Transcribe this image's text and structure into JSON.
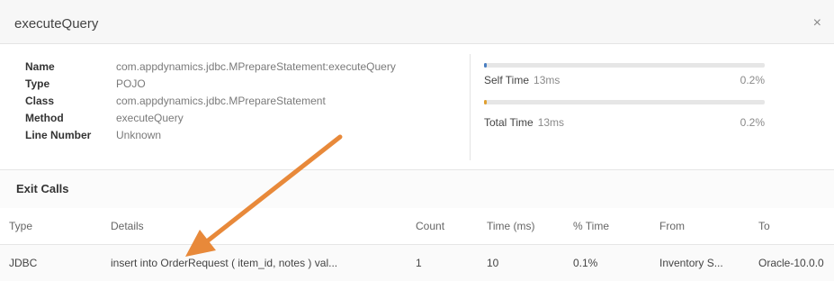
{
  "dialog": {
    "title": "executeQuery",
    "close_glyph": "×"
  },
  "properties": [
    {
      "label": "Name",
      "value": "com.appdynamics.jdbc.MPrepareStatement:executeQuery"
    },
    {
      "label": "Type",
      "value": "POJO"
    },
    {
      "label": "Class",
      "value": "com.appdynamics.jdbc.MPrepareStatement"
    },
    {
      "label": "Method",
      "value": "executeQuery"
    },
    {
      "label": "Line Number",
      "value": "Unknown"
    }
  ],
  "metrics": {
    "self_time": {
      "label": "Self Time",
      "value": "13ms",
      "percent": "0.2%",
      "fill": 0.002
    },
    "total_time": {
      "label": "Total Time",
      "value": "13ms",
      "percent": "0.2%",
      "fill": 0.002
    }
  },
  "colors": {
    "self_time_bar": "#4a7fc1",
    "total_time_bar": "#e0a030",
    "arrow": "#e8893a"
  },
  "exit_calls": {
    "title": "Exit Calls",
    "columns": [
      "Type",
      "Details",
      "Count",
      "Time (ms)",
      "% Time",
      "From",
      "To"
    ],
    "rows": [
      [
        "JDBC",
        "insert into OrderRequest ( item_id, notes ) val...",
        "1",
        "10",
        "0.1%",
        "Inventory S...",
        "Oracle-10.0.0"
      ]
    ]
  },
  "annotation": {
    "icon": "arrow-icon"
  }
}
